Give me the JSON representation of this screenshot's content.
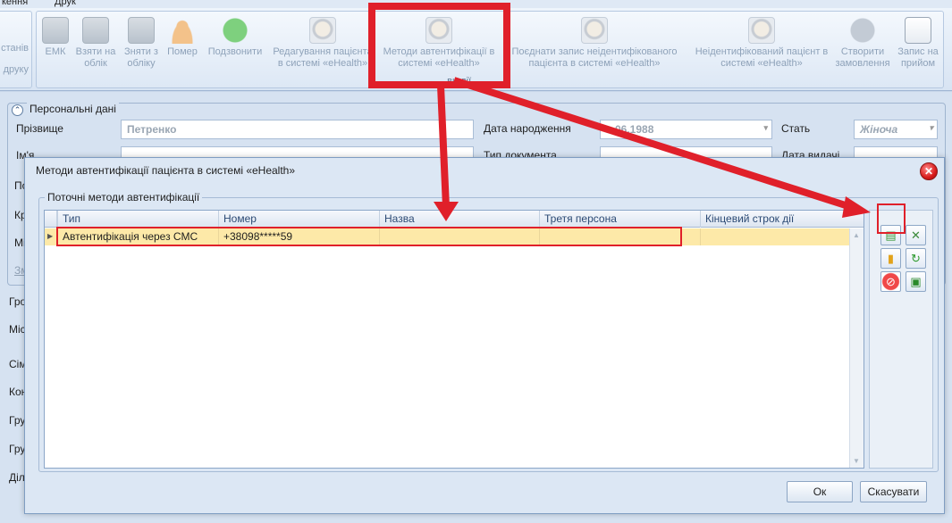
{
  "menubar": {
    "items": [
      "кення",
      "Друк"
    ]
  },
  "ribbon": {
    "left_group": {
      "line1": "станів",
      "line2": "друку"
    },
    "buttons": [
      {
        "label": "ЕМК",
        "icon": "ehr-card-icon"
      },
      {
        "label": "Взяти на облік",
        "icon": "register-card-icon"
      },
      {
        "label": "Зняти з обліку",
        "icon": "unregister-card-icon"
      },
      {
        "label": "Помер",
        "icon": "deceased-person-icon"
      },
      {
        "label": "Подзвонити",
        "icon": "phone-icon"
      },
      {
        "label": "Редагування пацієнта в системі «eHealth»",
        "icon": "patient-face-icon"
      },
      {
        "label": "Методи автентифікації в системі «eHealth»",
        "icon": "patient-face-icon"
      },
      {
        "label": "Поєднати запис неідентифікованого пацієнта в системі «eHealth»",
        "icon": "patient-face-icon"
      },
      {
        "label": "Неідентифікований пацієнт в системі «eHealth»",
        "icon": "patient-face-icon"
      },
      {
        "label": "Створити замовлення",
        "icon": "order-list-icon"
      },
      {
        "label": "Запис на прийом",
        "icon": "appointment-calendar-icon"
      }
    ],
    "group_label": "...ви дії"
  },
  "background_form": {
    "section_title": "Персональні дані",
    "fields": {
      "surname_label": "Прізвище",
      "surname_value": "Петренко",
      "birthdate_label": "Дата народження",
      "birthdate_value": "...06.1988",
      "sex_label": "Стать",
      "sex_value": "Жіноча",
      "name_label": "Ім'я",
      "doc_type_label": "Тип документа",
      "issue_date_label": "Дата видачі"
    },
    "side_labels": [
      "По",
      "Кр",
      "Мі",
      "Зм",
      "Гро",
      "Міс",
      "Сім",
      "Кон",
      "Гру",
      "Гру",
      "Діл"
    ]
  },
  "dialog": {
    "title": "Методи автентифікації пацієнта в системі «eHealth»",
    "group_title": "Поточні методи автентифікації",
    "columns": [
      "Тип",
      "Номер",
      "Назва",
      "Третя персона",
      "Кінцевий строк дії"
    ],
    "rows": [
      {
        "type": "Автентифікація через СМС",
        "number": "+38098*****59",
        "name": "",
        "third_person": "",
        "expiry": ""
      }
    ],
    "ok_label": "Ок",
    "cancel_label": "Скасувати"
  },
  "colors": {
    "annotation_red": "#e0202a",
    "selected_row": "#fde9a8",
    "dialog_bg": "#dce7f4"
  }
}
